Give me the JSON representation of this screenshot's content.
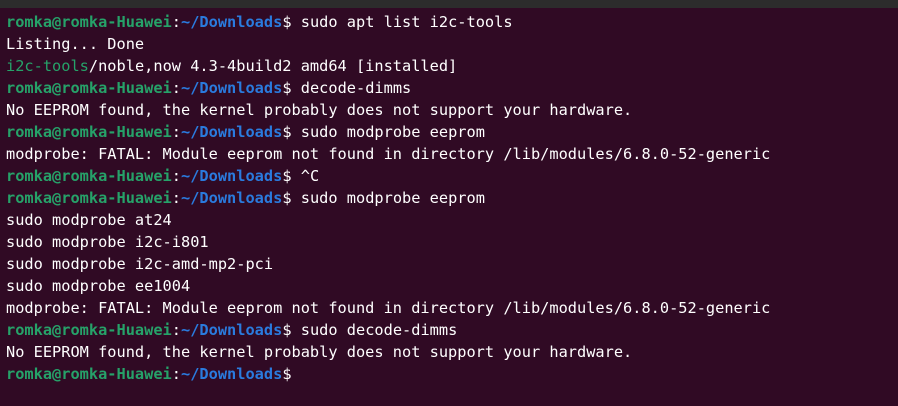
{
  "colors": {
    "background": "#300a24",
    "user_host": "#26a269",
    "path": "#2a7bde",
    "text": "#ffffff"
  },
  "prompt": {
    "user_host": "romka@romka-Huawei",
    "colon": ":",
    "path": "~/Downloads",
    "dollar": "$"
  },
  "lines": [
    {
      "kind": "prompt",
      "command": " sudo apt list i2c-tools"
    },
    {
      "kind": "text",
      "text": "Listing... Done"
    },
    {
      "kind": "pkg",
      "name": "i2c-tools",
      "rest": "/noble,now 4.3-4build2 amd64 [installed]"
    },
    {
      "kind": "prompt",
      "command": " decode-dimms"
    },
    {
      "kind": "text",
      "text": "No EEPROM found, the kernel probably does not support your hardware."
    },
    {
      "kind": "prompt",
      "command": " sudo modprobe eeprom"
    },
    {
      "kind": "text",
      "text": "modprobe: FATAL: Module eeprom not found in directory /lib/modules/6.8.0-52-generic"
    },
    {
      "kind": "prompt",
      "command": " ^C"
    },
    {
      "kind": "prompt",
      "command": " sudo modprobe eeprom"
    },
    {
      "kind": "text",
      "text": "sudo modprobe at24"
    },
    {
      "kind": "text",
      "text": "sudo modprobe i2c-i801"
    },
    {
      "kind": "text",
      "text": "sudo modprobe i2c-amd-mp2-pci"
    },
    {
      "kind": "text",
      "text": "sudo modprobe ee1004"
    },
    {
      "kind": "text",
      "text": "modprobe: FATAL: Module eeprom not found in directory /lib/modules/6.8.0-52-generic"
    },
    {
      "kind": "prompt",
      "command": " sudo decode-dimms"
    },
    {
      "kind": "text",
      "text": "No EEPROM found, the kernel probably does not support your hardware."
    },
    {
      "kind": "prompt",
      "command": ""
    }
  ]
}
